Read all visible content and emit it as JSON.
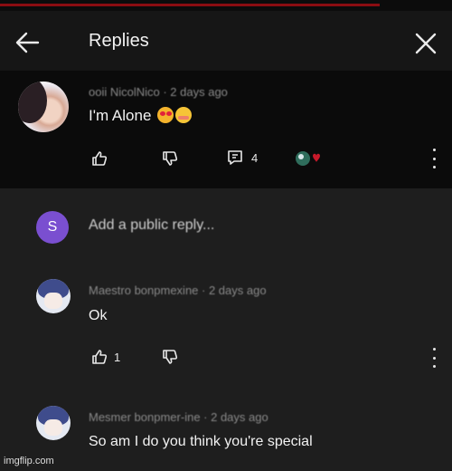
{
  "header": {
    "title": "Replies"
  },
  "parent_comment": {
    "author": "ooii NicolNico · 2 days ago",
    "text": "I'm Alone",
    "reply_count": "4"
  },
  "reply_box": {
    "avatar_letter": "S",
    "placeholder": "Add a public reply..."
  },
  "replies": [
    {
      "author": "Maestro bonpmexine · 2 days ago",
      "text": "Ok",
      "like_count": "1"
    },
    {
      "author": "Mesmer bonpmer-ine · 2 days ago",
      "text": "So am I do you think you're special"
    }
  ],
  "watermark": "imgflip.com",
  "colors": {
    "background": "#1e1e1e",
    "parent_background": "#0b0b0b",
    "reply_avatar": "#7a4fd0",
    "accent_bar": "#8b0d12"
  }
}
